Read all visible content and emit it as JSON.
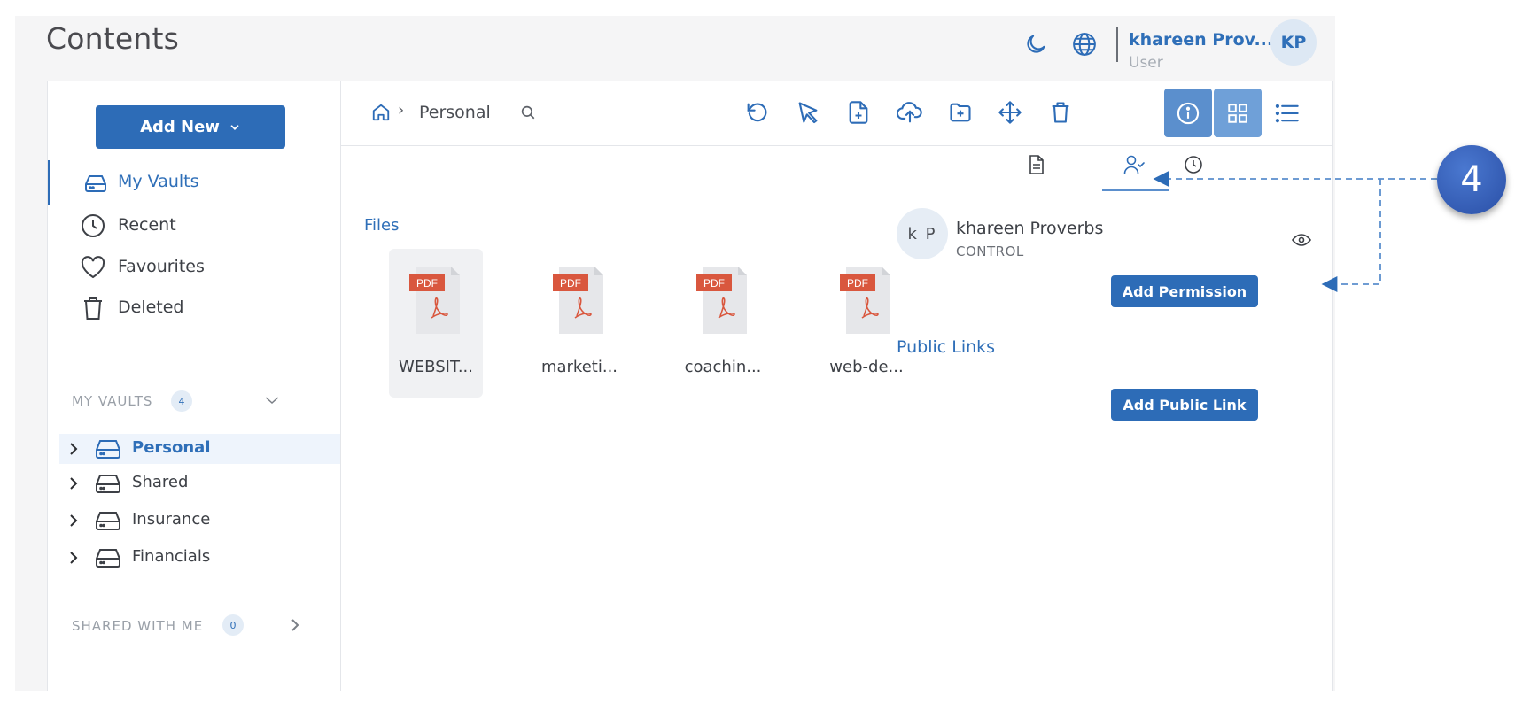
{
  "header": {
    "title": "Contents",
    "icons": [
      "moon-icon",
      "globe-icon"
    ],
    "user": {
      "name": "khareen Prov...",
      "role": "User",
      "initials": "KP"
    }
  },
  "sidebar": {
    "add_new_label": "Add New",
    "nav": [
      {
        "label": "My Vaults",
        "icon": "drive-icon",
        "active": true
      },
      {
        "label": "Recent",
        "icon": "clock-icon"
      },
      {
        "label": "Favourites",
        "icon": "heart-icon"
      },
      {
        "label": "Deleted",
        "icon": "trash-icon"
      }
    ],
    "my_vaults": {
      "title": "MY VAULTS",
      "count": "4"
    },
    "vaults": [
      {
        "label": "Personal",
        "selected": true
      },
      {
        "label": "Shared"
      },
      {
        "label": "Insurance"
      },
      {
        "label": "Financials"
      }
    ],
    "shared_with_me": {
      "title": "SHARED WITH ME",
      "count": "0"
    }
  },
  "breadcrumb": {
    "current": "Personal"
  },
  "toolbar": {
    "actions": [
      "refresh-icon",
      "select-icon",
      "new-file-icon",
      "upload-icon",
      "new-folder-icon",
      "move-icon",
      "delete-icon"
    ],
    "views": [
      "info-icon",
      "grid-view-icon",
      "list-view-icon"
    ]
  },
  "files": {
    "section_label": "Files",
    "type_label": "PDF",
    "items": [
      {
        "name": "WEBSIT...",
        "selected": true
      },
      {
        "name": "marketi..."
      },
      {
        "name": "coachin..."
      },
      {
        "name": "web-de..."
      }
    ]
  },
  "details": {
    "tabs": [
      "document-icon",
      "user-check-icon",
      "history-icon"
    ],
    "permission": {
      "initials": "k P",
      "name": "khareen Proverbs",
      "level": "CONTROL"
    },
    "add_permission_label": "Add Permission",
    "public_links_label": "Public Links",
    "add_public_link_label": "Add Public Link"
  },
  "annotation": {
    "step": "4"
  },
  "colors": {
    "accent": "#2d6cb7",
    "callout": "#3a63bf"
  }
}
